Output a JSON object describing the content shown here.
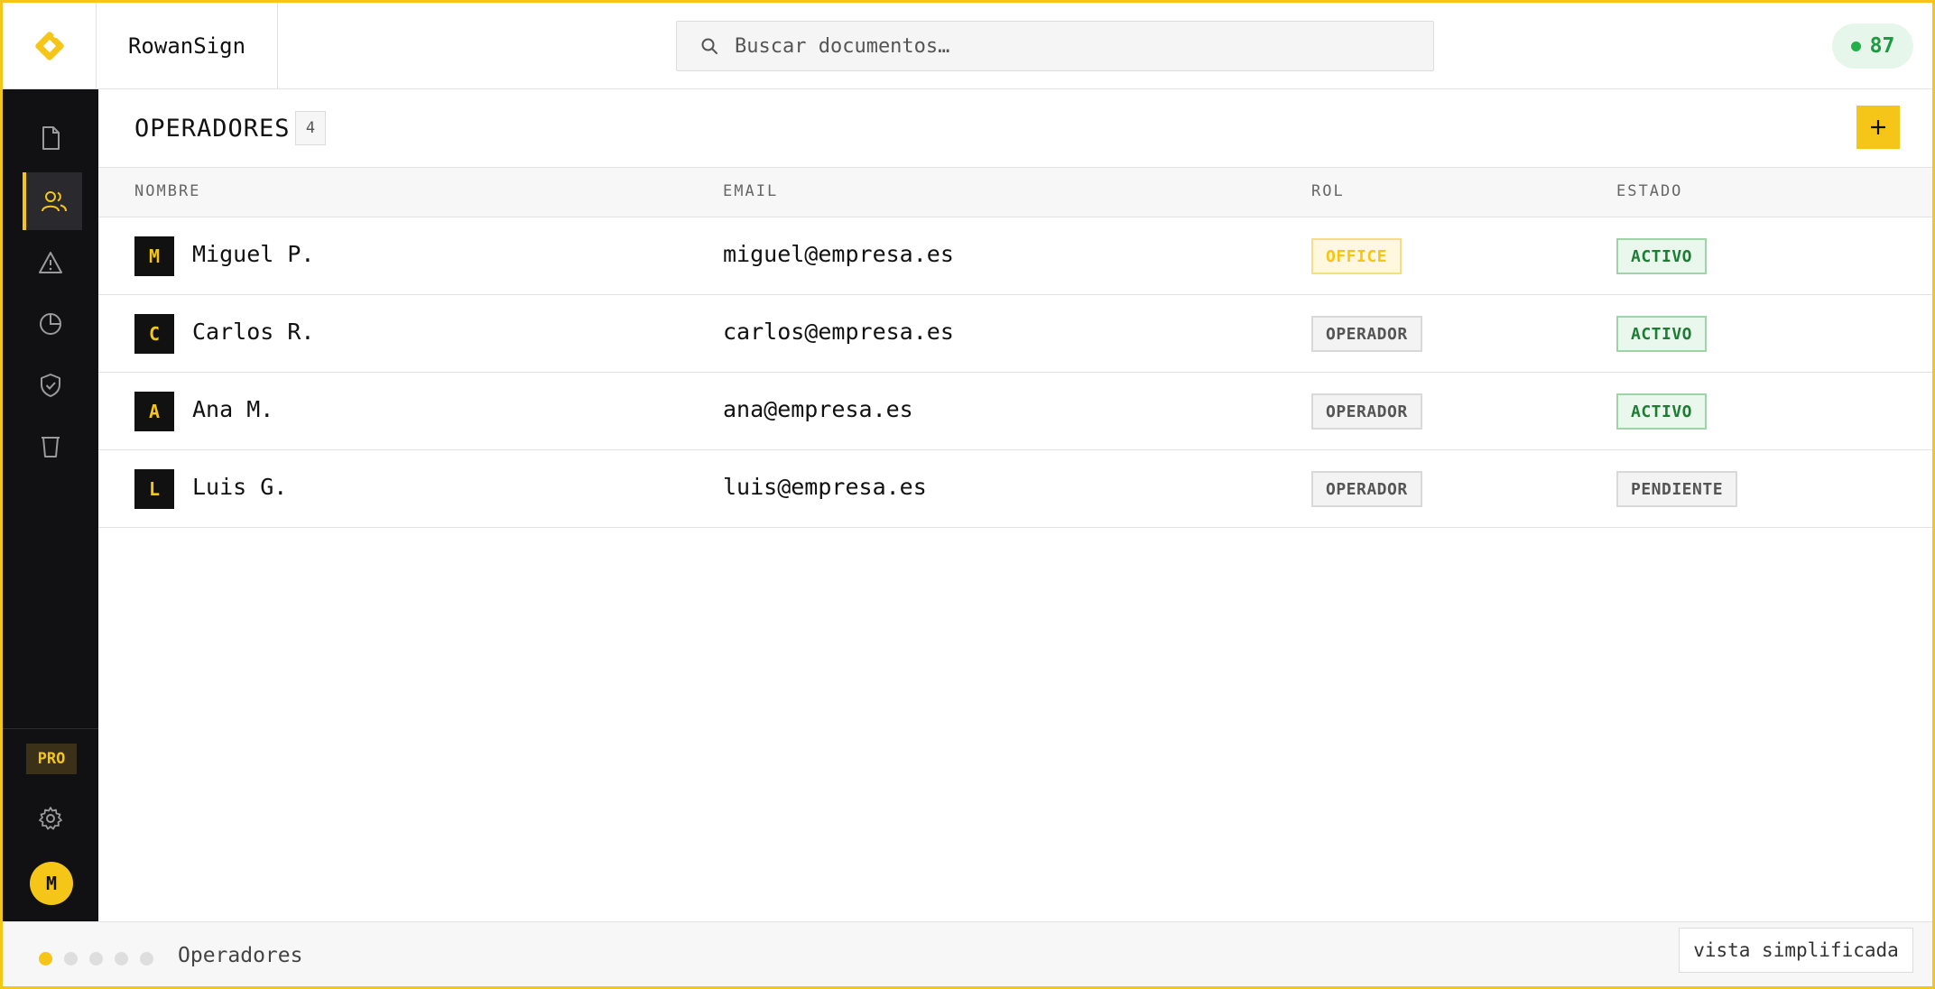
{
  "app": {
    "name": "RowanSign",
    "logo_icon": "rowan-diamond-logo-icon",
    "accent": "#f5c518"
  },
  "search": {
    "placeholder": "Buscar documentos…",
    "value": ""
  },
  "header": {
    "counter": "87",
    "counter_status_color": "#22b04b"
  },
  "sidebar": {
    "items": [
      {
        "id": "documents",
        "icon": "file-icon",
        "active": false
      },
      {
        "id": "users",
        "icon": "users-icon",
        "active": true
      },
      {
        "id": "alerts",
        "icon": "alert-triangle-icon",
        "active": false
      },
      {
        "id": "reports",
        "icon": "pie-chart-icon",
        "active": false
      },
      {
        "id": "security",
        "icon": "shield-check-icon",
        "active": false
      },
      {
        "id": "trash",
        "icon": "trash-icon",
        "active": false
      }
    ],
    "plan_badge": "PRO",
    "settings_icon": "gear-icon",
    "user_initial": "M"
  },
  "page": {
    "title": "OPERADORES",
    "count": "4",
    "add_label": "+"
  },
  "table": {
    "headers": {
      "name": "NOMBRE",
      "email": "EMAIL",
      "role": "ROL",
      "status": "ESTADO"
    },
    "rows": [
      {
        "initial": "M",
        "name": "Miguel P.",
        "email": "miguel@empresa.es",
        "role": "OFFICE",
        "status": "ACTIVO"
      },
      {
        "initial": "C",
        "name": "Carlos R.",
        "email": "carlos@empresa.es",
        "role": "OPERADOR",
        "status": "ACTIVO"
      },
      {
        "initial": "A",
        "name": "Ana M.",
        "email": "ana@empresa.es",
        "role": "OPERADOR",
        "status": "ACTIVO"
      },
      {
        "initial": "L",
        "name": "Luis G.",
        "email": "luis@empresa.es",
        "role": "OPERADOR",
        "status": "PENDIENTE"
      }
    ]
  },
  "footer": {
    "steps_total": 5,
    "step_current": 1,
    "label": "Operadores",
    "simple_view_label": "vista simplificada"
  }
}
